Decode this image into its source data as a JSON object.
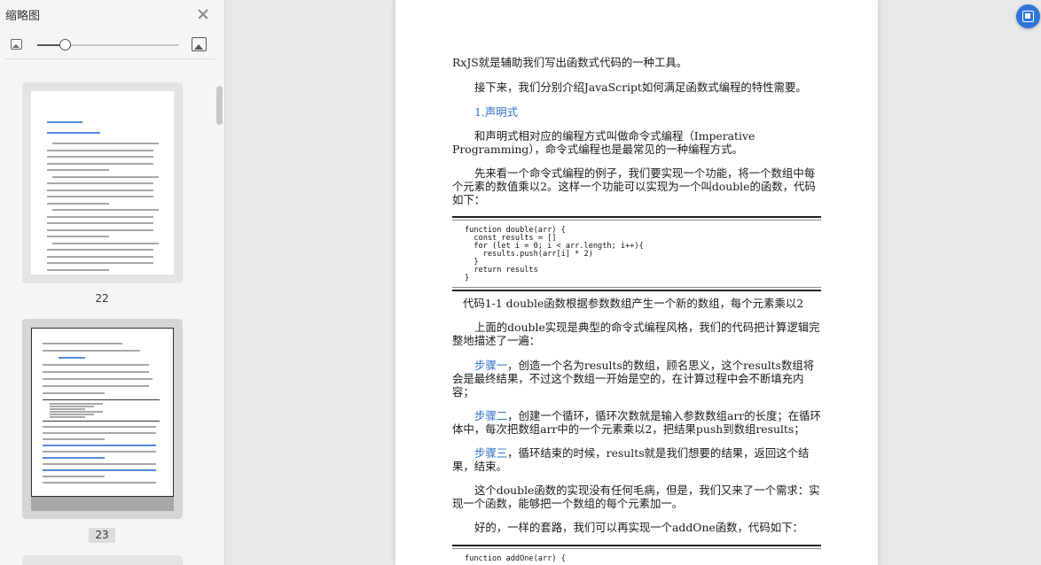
{
  "sidebar": {
    "title": "缩略图",
    "close_icon": "close-icon",
    "zoom_small_icon": "image-small-icon",
    "zoom_large_icon": "image-large-icon",
    "zoom_level": 0.2,
    "thumbnails": [
      {
        "page": "22",
        "selected": false
      },
      {
        "page": "23",
        "selected": true
      }
    ]
  },
  "document": {
    "p1": "RxJS就是辅助我们写出函数式代码的一种工具。",
    "p2": "接下来，我们分别介绍JavaScript如何满足函数式编程的特性需要。",
    "h1": "1.声明式",
    "p3": "和声明式相对应的编程方式叫做命令式编程（Imperative Programming），命令式编程也是最常见的一种编程方式。",
    "p4": "先来看一个命令式编程的例子，我们要实现一个功能，将一个数组中每个元素的数值乘以2。这样一个功能可以实现为一个叫double的函数，代码如下：",
    "code1": [
      "function double(arr) {",
      "  const results = []",
      "  for (let i = 0; i < arr.length; i++){",
      "    results.push(arr[i] * 2)",
      "  }",
      "  return results",
      "}"
    ],
    "caption1": "代码1-1    double函数根据参数数组产生一个新的数组，每个元素乘以2",
    "p5": "上面的double实现是典型的命令式编程风格，我们的代码把计算逻辑完整地描述了一遍：",
    "step1_label": "步骤一",
    "step1_text": "，创造一个名为results的数组，顾名思义，这个results数组将会是最终结果，不过这个数组一开始是空的，在计算过程中会不断填充内容；",
    "step2_label": "步骤二",
    "step2_text": "，创建一个循环，循环次数就是输入参数数组arr的长度；在循环体中，每次把数组arr中的一个元素乘以2，把结果push到数组results；",
    "step3_label": "步骤三",
    "step3_text": "，循环结束的时候，results就是我们想要的结果，返回这个结果，结束。",
    "p6": "这个double函数的实现没有任何毛病，但是，我们又来了一个需求：实现一个函数，能够把一个数组的每个元素加一。",
    "p7": "好的，一样的套路，我们可以再实现一个addOne函数，代码如下：",
    "code2_first": "function addOne(arr) {"
  },
  "fab_icon": "translate-icon",
  "colors": {
    "accent_blue": "#2f6fc7",
    "fab_blue": "#2f74d8"
  }
}
